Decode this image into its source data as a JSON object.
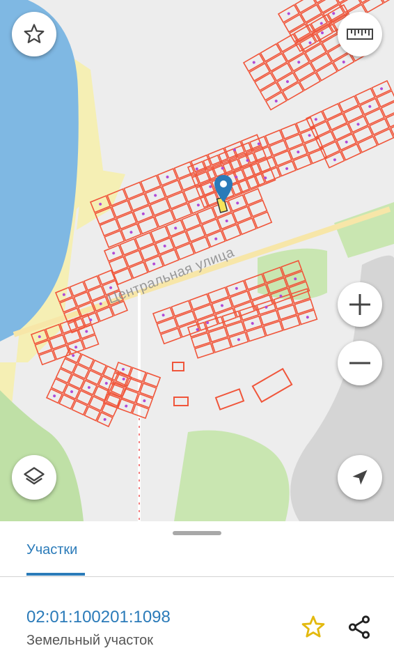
{
  "map": {
    "street_label": "Центральная улица",
    "buttons": {
      "favorite": {
        "icon": "star-outline-icon"
      },
      "ruler": {
        "icon": "ruler-icon"
      },
      "zoom_in": {
        "icon": "plus-icon"
      },
      "zoom_out": {
        "icon": "minus-icon"
      },
      "layers": {
        "icon": "layers-icon"
      },
      "my_location": {
        "icon": "navigation-arrow-icon"
      }
    },
    "marker": {
      "icon": "map-pin-icon",
      "color": "#2b7bb9"
    },
    "colors": {
      "parcel_stroke": "#f0553a",
      "water": "#7fb8e3",
      "beach": "#f5efb4",
      "green": "#bfe0a6"
    }
  },
  "sheet": {
    "tab_label": "Участки",
    "result": {
      "cadastral_number": "02:01:100201:1098",
      "object_type": "Земельный участок"
    },
    "actions": {
      "favorite_icon": "star-outline-icon",
      "favorite_color": "#e3b90f",
      "share_icon": "share-icon"
    }
  }
}
